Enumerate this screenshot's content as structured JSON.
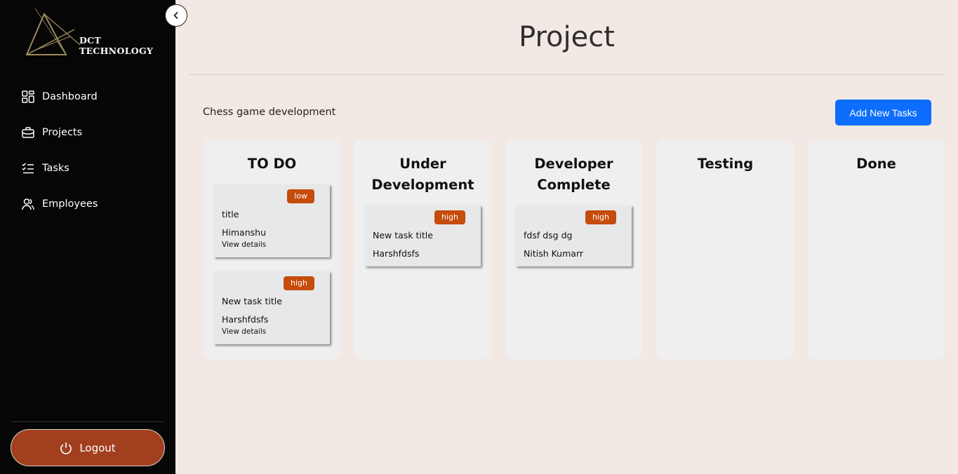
{
  "sidebar": {
    "logo_line1": "DCT",
    "logo_line2": "TECHNOLOGY",
    "items": [
      {
        "label": "Dashboard",
        "icon": "dashboard-icon"
      },
      {
        "label": "Projects",
        "icon": "briefcase-icon"
      },
      {
        "label": "Tasks",
        "icon": "task-list-icon"
      },
      {
        "label": "Employees",
        "icon": "users-icon"
      }
    ],
    "logout_label": "Logout"
  },
  "header": {
    "title": "Project"
  },
  "project": {
    "name": "Chess game development",
    "add_button_label": "Add New Tasks"
  },
  "columns": [
    {
      "title": "TO DO",
      "cards": [
        {
          "priority": "low",
          "title": "title",
          "assignee": "Himanshu",
          "link": "View details"
        },
        {
          "priority": "high",
          "title": "New task title",
          "assignee": "Harshfdsfs",
          "link": "View details"
        }
      ]
    },
    {
      "title": "Under Development",
      "cards": [
        {
          "priority": "high",
          "title": "New task title",
          "assignee": "Harshfdsfs"
        }
      ]
    },
    {
      "title": "Developer Complete",
      "cards": [
        {
          "priority": "high",
          "title": "fdsf dsg dg",
          "assignee": "Nitish Kumarr"
        }
      ]
    },
    {
      "title": "Testing",
      "cards": []
    },
    {
      "title": "Done",
      "cards": []
    }
  ],
  "colors": {
    "sidebar_bg": "#060606",
    "page_bg": "#f3e9e4",
    "accent_button": "#0d6efd",
    "logout_button": "#a23f1f",
    "priority_badge": "#c54c0b"
  }
}
